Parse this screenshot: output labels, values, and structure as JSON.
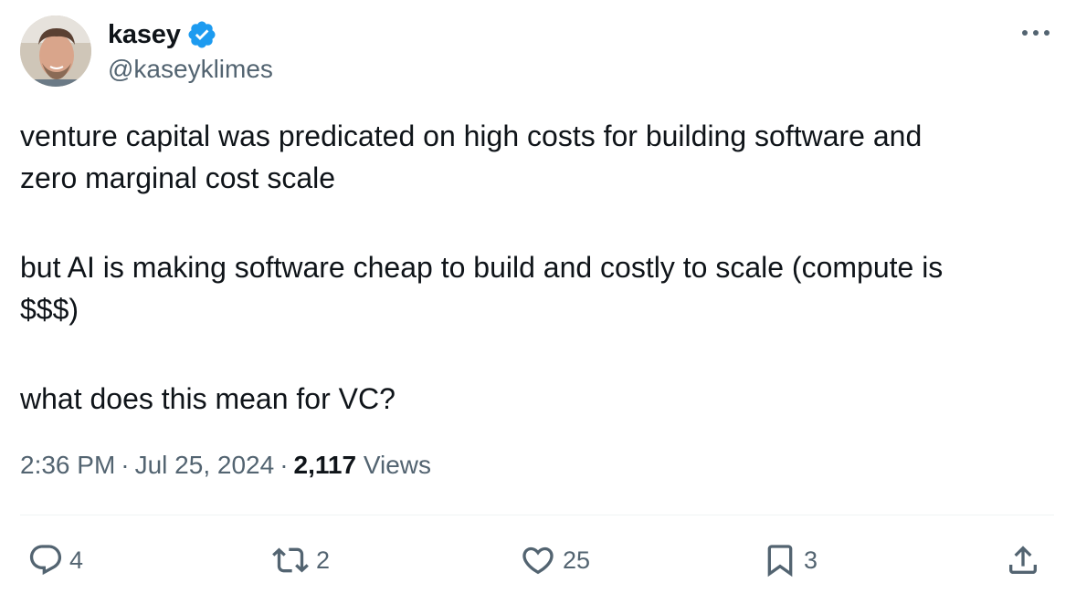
{
  "author": {
    "display_name": "kasey",
    "handle": "@kaseyklimes",
    "verified": true
  },
  "tweet": {
    "paragraphs": [
      [
        "venture capital was predicated on high costs for building software and",
        "zero marginal cost scale"
      ],
      [
        "but AI is making software cheap to build and costly to scale (compute is",
        "$$$)"
      ],
      [
        "what does this mean for VC?"
      ]
    ],
    "time": "2:36 PM",
    "date": "Jul 25, 2024",
    "separator": "·",
    "views_count": "2,117",
    "views_label": "Views"
  },
  "actions": {
    "replies": "4",
    "retweets": "2",
    "likes": "25",
    "bookmarks": "3"
  },
  "colors": {
    "verified_badge": "#1d9bf0",
    "secondary_text": "#536471",
    "primary_text": "#0f1419",
    "divider": "#eff3f4"
  },
  "icons": {
    "more": "more-dots-icon",
    "reply": "reply-bubble-icon",
    "retweet": "retweet-icon",
    "like": "heart-icon",
    "bookmark": "bookmark-icon",
    "share": "share-upload-icon"
  }
}
